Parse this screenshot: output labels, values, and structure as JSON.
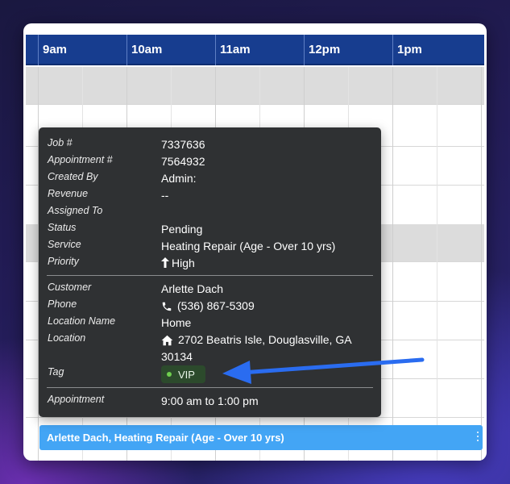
{
  "timeline": {
    "hours": [
      "9am",
      "10am",
      "11am",
      "12pm",
      "1pm"
    ]
  },
  "event": {
    "title": "Arlette Dach, Heating Repair (Age - Over 10 yrs)"
  },
  "tooltip": {
    "job_number": {
      "label": "Job #",
      "value": "7337636"
    },
    "appointment_number": {
      "label": "Appointment #",
      "value": "7564932"
    },
    "created_by": {
      "label": "Created By",
      "value": "Admin:"
    },
    "revenue": {
      "label": "Revenue",
      "value": "--"
    },
    "assigned_to": {
      "label": "Assigned To",
      "value": ""
    },
    "status": {
      "label": "Status",
      "value": "Pending"
    },
    "service": {
      "label": "Service",
      "value": "Heating Repair (Age - Over 10 yrs)"
    },
    "priority": {
      "label": "Priority",
      "value": "High",
      "icon": "arrow-up-icon"
    },
    "customer": {
      "label": "Customer",
      "value": "Arlette Dach"
    },
    "phone": {
      "label": "Phone",
      "value": "(536) 867-5309",
      "icon": "phone-icon"
    },
    "location_name": {
      "label": "Location Name",
      "value": "Home"
    },
    "location": {
      "label": "Location",
      "line1": "2702 Beatris Isle, Douglasville, GA",
      "line2": "30134",
      "icon": "home-icon"
    },
    "tag": {
      "label": "Tag",
      "value": "VIP",
      "icon": "status-dot-icon"
    },
    "appointment": {
      "label": "Appointment",
      "value": "9:00 am to 1:00 pm"
    }
  },
  "colors": {
    "header_bg": "#173d8f",
    "event_bar": "#43a5f5",
    "tooltip_bg": "#2f3133",
    "tag_chip_bg": "#2c4a2c",
    "tag_dot": "#6fcf4f",
    "annotation_arrow": "#2a6cf0"
  }
}
